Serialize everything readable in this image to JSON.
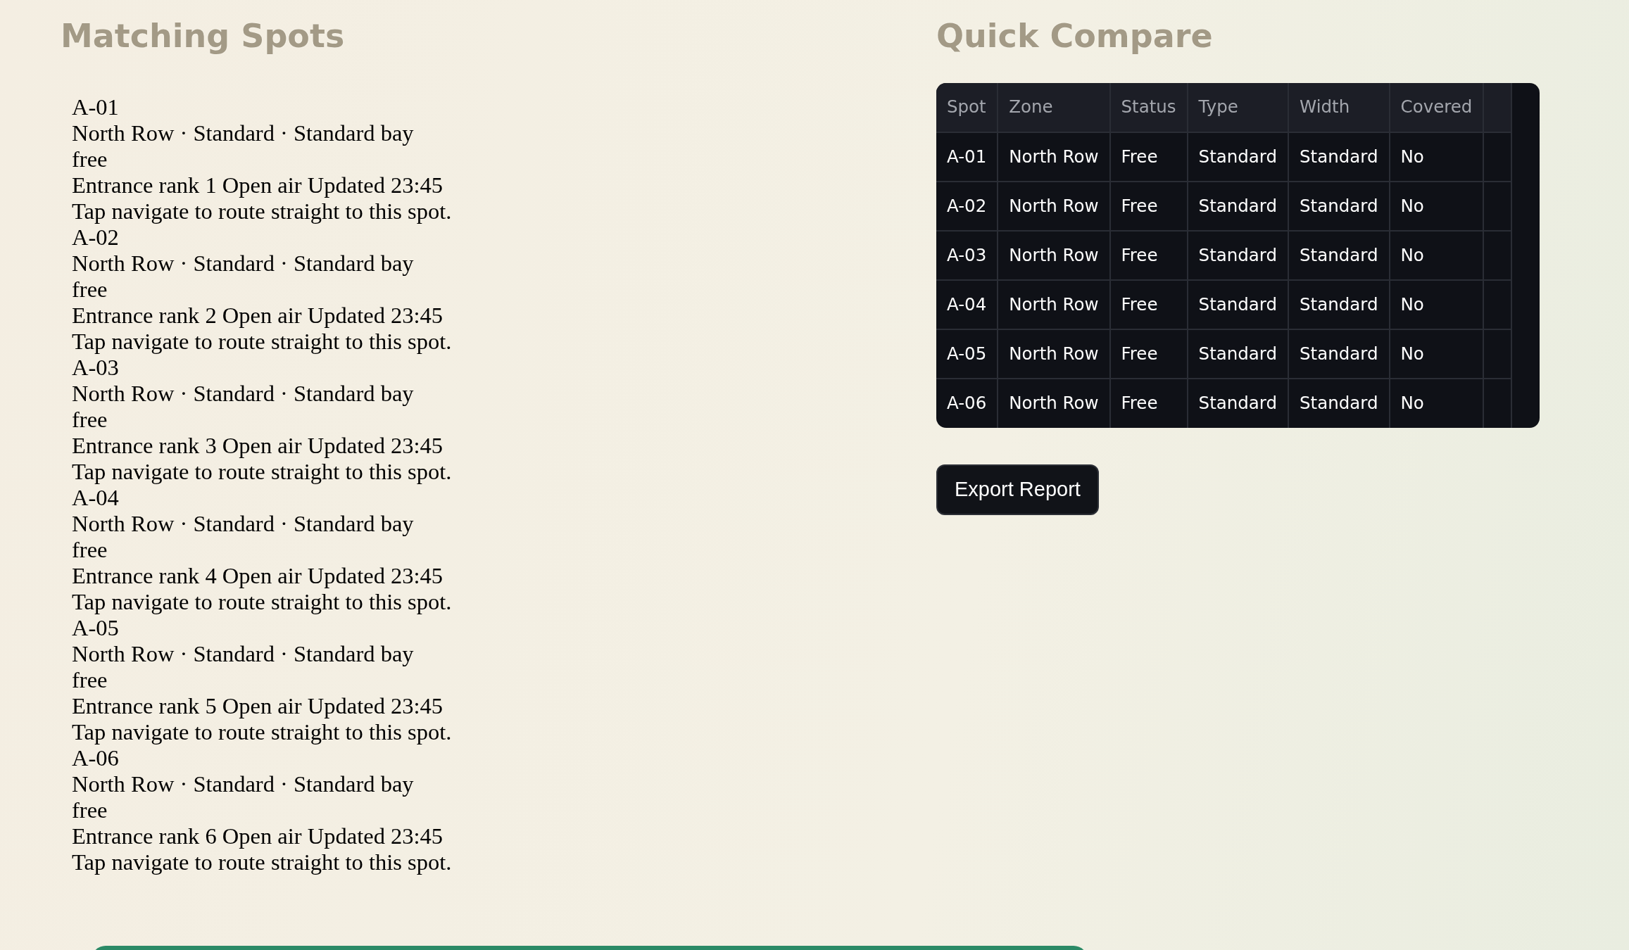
{
  "matching_spots": {
    "title": "Matching Spots",
    "spots": [
      {
        "spot": "A-01",
        "details": "North Row · Standard · Standard bay",
        "status": "free",
        "info": "Entrance rank 1 Open air Updated 23:45",
        "hint": "Tap navigate to route straight to this spot."
      },
      {
        "spot": "A-02",
        "details": "North Row · Standard · Standard bay",
        "status": "free",
        "info": "Entrance rank 2 Open air Updated 23:45",
        "hint": "Tap navigate to route straight to this spot."
      },
      {
        "spot": "A-03",
        "details": "North Row · Standard · Standard bay",
        "status": "free",
        "info": "Entrance rank 3 Open air Updated 23:45",
        "hint": "Tap navigate to route straight to this spot."
      },
      {
        "spot": "A-04",
        "details": "North Row · Standard · Standard bay",
        "status": "free",
        "info": "Entrance rank 4 Open air Updated 23:45",
        "hint": "Tap navigate to route straight to this spot."
      },
      {
        "spot": "A-05",
        "details": "North Row · Standard · Standard bay",
        "status": "free",
        "info": "Entrance rank 5 Open air Updated 23:45",
        "hint": "Tap navigate to route straight to this spot."
      },
      {
        "spot": "A-06",
        "details": "North Row · Standard · Standard bay",
        "status": "free",
        "info": "Entrance rank 6 Open air Updated 23:45",
        "hint": "Tap navigate to route straight to this spot."
      }
    ]
  },
  "quick_compare": {
    "title": "Quick Compare",
    "table": {
      "columns": [
        "Spot",
        "Zone",
        "Status",
        "Type",
        "Width",
        "Covered"
      ],
      "rows": [
        [
          "A-01",
          "North Row",
          "Free",
          "Standard",
          "Standard",
          "No"
        ],
        [
          "A-02",
          "North Row",
          "Free",
          "Standard",
          "Standard",
          "No"
        ],
        [
          "A-03",
          "North Row",
          "Free",
          "Standard",
          "Standard",
          "No"
        ],
        [
          "A-04",
          "North Row",
          "Free",
          "Standard",
          "Standard",
          "No"
        ],
        [
          "A-05",
          "North Row",
          "Free",
          "Standard",
          "Standard",
          "No"
        ],
        [
          "A-06",
          "North Row",
          "Free",
          "Standard",
          "Standard",
          "No"
        ]
      ]
    },
    "export_button": "Export Report"
  }
}
